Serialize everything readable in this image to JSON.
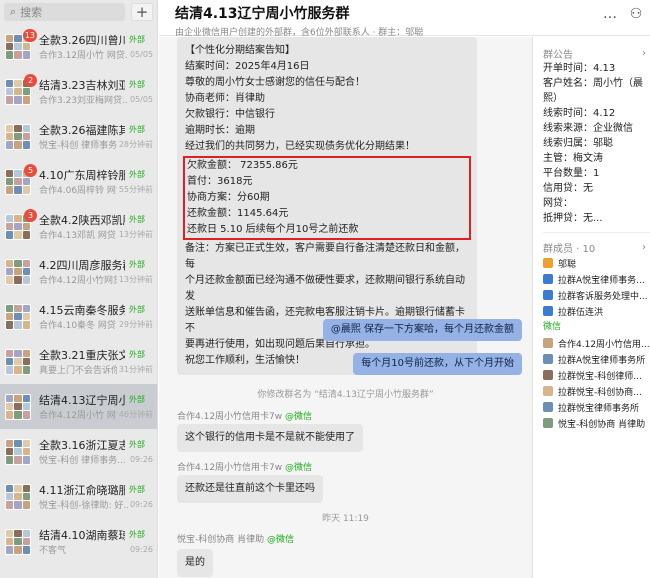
{
  "search": {
    "placeholder": "搜索",
    "add_label": "+"
  },
  "chats": [
    {
      "name": "全款3.26四川曾川...",
      "tag": "外部",
      "preview": "合作3.12周小竹 网贷...",
      "time": "05/05",
      "badge": "13"
    },
    {
      "name": "结清3.23吉林刘亚...",
      "tag": "外部",
      "preview": "合作3.23刘亚梅网贷...",
      "time": "05/05",
      "badge": "2"
    },
    {
      "name": "全款3.26福建陈其...",
      "tag": "外部",
      "preview": "悦宝-科创 律师事务...",
      "time": "28分钟前",
      "badge": ""
    },
    {
      "name": "4.10广东周梓铃服...",
      "tag": "外部",
      "preview": "合作4.06周梓铃 网贷...",
      "time": "55分钟前",
      "badge": "5"
    },
    {
      "name": "全款4.2陕西邓凯服...",
      "tag": "外部",
      "preview": "合作4.13邓凯 网贷...",
      "time": "13分钟前",
      "badge": "3"
    },
    {
      "name": "4.2四川周彦服务群",
      "tag": "外部",
      "preview": "合作4.12周小竹网贷...",
      "time": "13分钟前",
      "badge": ""
    },
    {
      "name": "4.15云南秦冬服务群",
      "tag": "外部",
      "preview": "合作4.10秦冬 网贷...",
      "time": "29分钟前",
      "badge": ""
    },
    {
      "name": "全款3.21重庆张文...",
      "tag": "外部",
      "preview": "真要上门不会告诉你...",
      "time": "31分钟前",
      "badge": ""
    },
    {
      "name": "结清4.13辽宁周小...",
      "tag": "外部",
      "preview": "合作4.12周小竹 网贷...",
      "time": "46分钟前",
      "badge": ""
    },
    {
      "name": "全款3.16浙江夏志...",
      "tag": "外部",
      "preview": "悦宝-科创 律师事务...",
      "time": "09:26",
      "badge": ""
    },
    {
      "name": "4.11浙江俞晓璐服...",
      "tag": "外部",
      "preview": "悦宝-科创-徐律助: 好...",
      "time": "09:26",
      "badge": ""
    },
    {
      "name": "结清4.10湖南蔡琼...",
      "tag": "外部",
      "preview": "不客气",
      "time": "09:26",
      "badge": ""
    }
  ],
  "header": {
    "title": "结清4.13辽宁周小竹服务群",
    "subtitle": "由企业微信用户创建的外部群，含6位外部联系人 · 群主：邬聪"
  },
  "messages": {
    "notice_lines": [
      "【个性化分期结案告知】",
      "结案时间：2025年4月16日",
      "尊敬的周小竹女士感谢您的信任与配合！",
      "协商老师：肖律助",
      "欠款银行：中信银行",
      "逾期时长：逾期",
      "经过我们的共同努力，已经实现债务优化分期结果！"
    ],
    "boxed_lines": [
      "欠款金额： 72355.86元",
      "首付：3618元",
      "协商方案：分60期",
      "还款金额：1145.64元",
      "还款日 5.10 后续每个月10号之前还款"
    ],
    "tail_lines": [
      "备注：方案已正式生效，客户需要自行备注清楚还款日和金额，每",
      "个月还款金额面已经沟通不做硬性要求，还款期间银行系统自动发",
      "送账单信息和催告函，还完款电客服注销卡片。逾期银行储蓄卡不",
      "要再进行使用，如出现问题后果自行承担。",
      "祝您工作顺利，生活愉快！"
    ],
    "right_1": "@晨熙 保存一下方案哈，每个月还款金额",
    "right_2": "每个月10号前还款，从下个月开始",
    "system_rename": "你修改群名为 “结清4.13辽宁周小竹服务群”",
    "sender_1": "合作4.12周小竹信用卡7w",
    "sender_1_tag": "@微信",
    "left_1": "这个银行的信用卡是不是就不能使用了",
    "sender_2": "合作4.12周小竹信用卡7w",
    "sender_2_tag": "@微信",
    "left_2": "还款还是往直前这个卡里还吗",
    "time_sep": "昨天 11:19",
    "sender_3": "悦宝-科创协商 肖律助",
    "sender_3_tag": "@微信",
    "left_3": "是的"
  },
  "right_panel": {
    "notice_label": "群公告",
    "notice": [
      "开单时间：4.13",
      "客户姓名：周小竹（晨",
      "熙）",
      "线索时间：4.12",
      "线索来源：企业微信",
      "线索归属：邬聪",
      "主管：梅文涛",
      "平台数量：1",
      "信用贷：无",
      "网贷：",
      "抵押贷：无..."
    ],
    "members_label": "群成员 · 10",
    "members": [
      "邬聪",
      "拉群A悦宝律师事务...",
      "拉群客诉服务处理中...",
      "拉群伍连洪"
    ],
    "wx_label": "微信",
    "wx_members": [
      "合作4.12周小竹信用...",
      "拉群A悦宝律师事务所",
      "拉群悦宝-科创律师...",
      "拉群悦宝-科创协商...",
      "拉群悦宝律师事务所",
      "悦宝-科创协商 肖律助"
    ],
    "colors": {
      "ext_green": "#1aad19",
      "badge_red": "#e74c3c",
      "bubble_blue": "#95b2e6",
      "box_red": "#e02020"
    }
  }
}
